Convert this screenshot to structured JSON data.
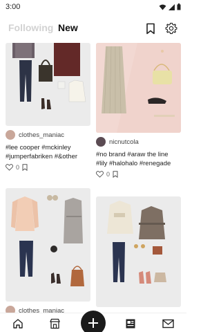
{
  "status": {
    "time": "3:00"
  },
  "header": {
    "tab_following": "Following",
    "tab_new": "New"
  },
  "icons": {
    "wifi": "wifi-icon",
    "signal": "signal-icon",
    "battery": "battery-icon",
    "bookmark": "bookmark-icon",
    "settings": "gear-icon",
    "like": "heart-icon",
    "save": "bookmark-icon"
  },
  "posts": [
    {
      "username": "clothes_maniac",
      "caption": "#lee cooper #mckinley #jumperfabriken #&other stories",
      "likes": "0"
    },
    {
      "username": "nicnutcola",
      "caption_line1": "#no brand #araw the line",
      "caption_line2": "#lily #halohalo #renegade",
      "likes": "0"
    },
    {
      "username": "clothes_maniac"
    },
    {}
  ],
  "nav": [
    "home-icon",
    "shop-icon",
    "add-icon",
    "newspaper-icon",
    "mail-icon"
  ]
}
